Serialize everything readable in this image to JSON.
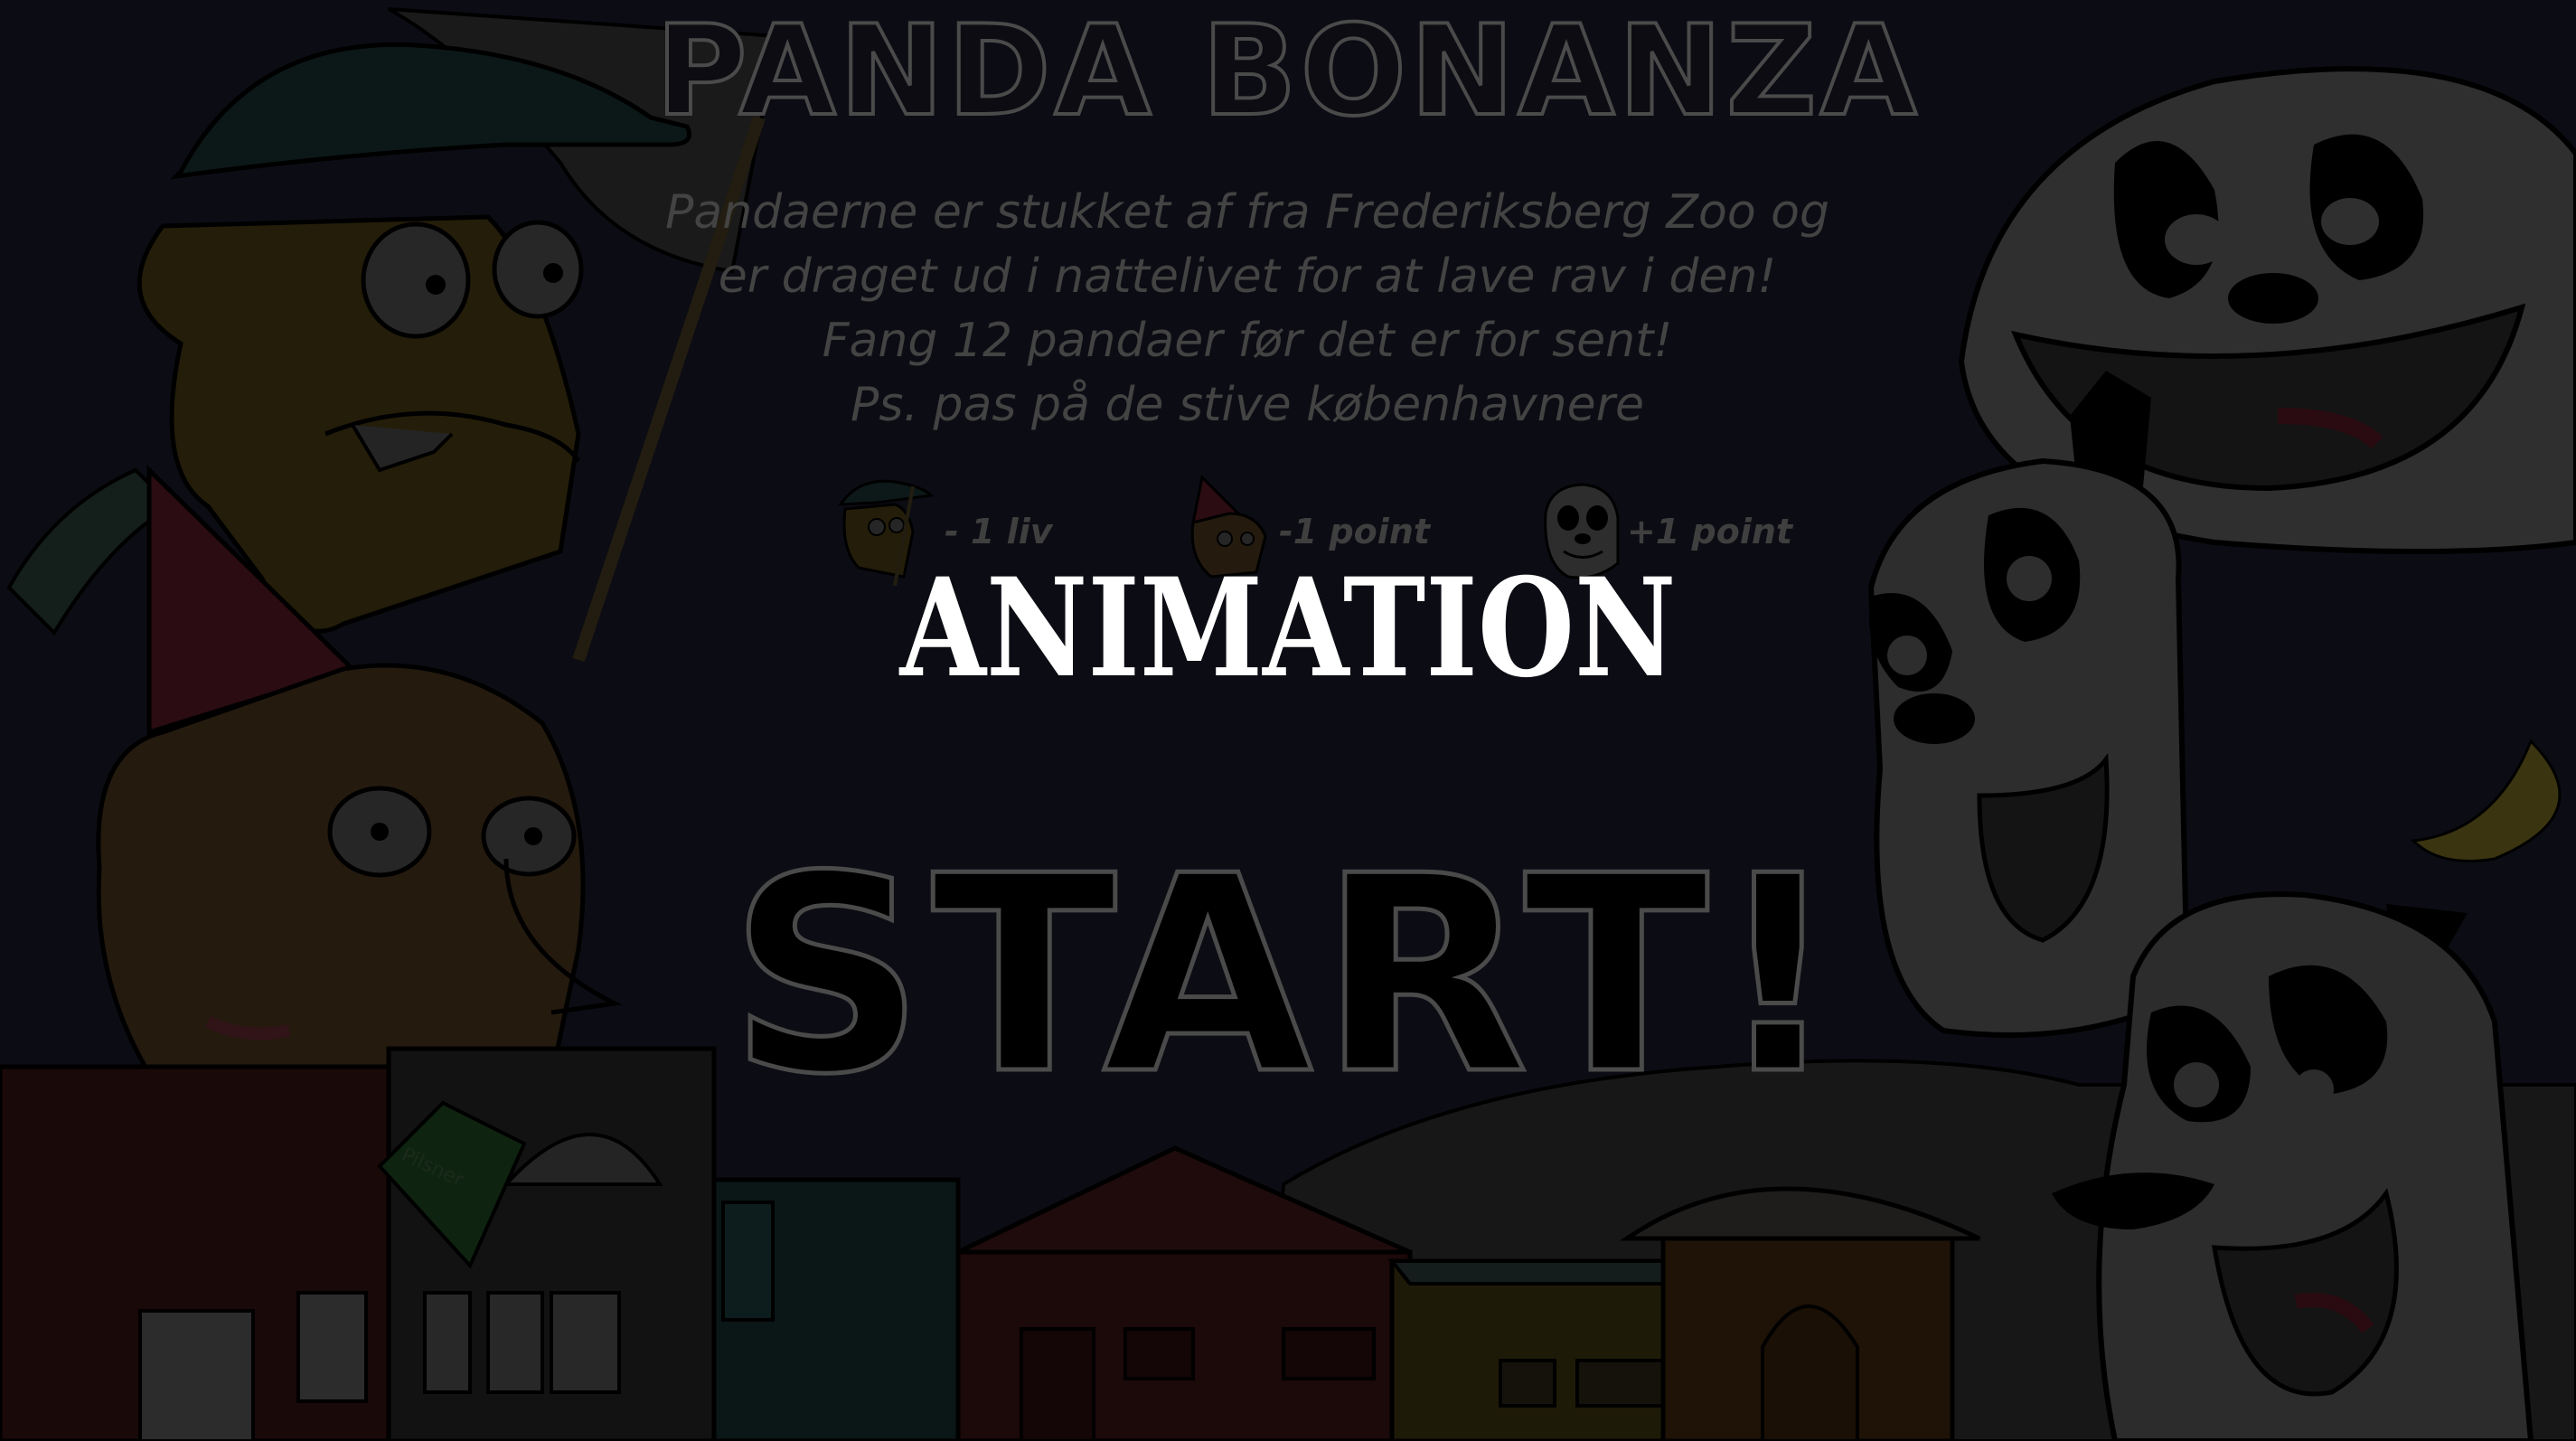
{
  "game": {
    "title": "PANDA BONANZA",
    "intro_lines": [
      "Pandaerne er stukket af fra Frederiksberg Zoo og",
      "er draget ud i nattelivet for at lave rav i den!",
      "Fang 12 pandaer før det er for sent!",
      "Ps. pas på de stive københavnere"
    ],
    "legend": [
      {
        "icon": "cap-man-face-icon",
        "label": "- 1 liv"
      },
      {
        "icon": "party-hat-man-face-icon",
        "label": "-1 point"
      },
      {
        "icon": "panda-face-icon",
        "label": "+1 point"
      }
    ],
    "overlay_text": "ANIMATION",
    "start_button": "START!",
    "bottle_label": "Pilsner"
  },
  "colors": {
    "background": "#0c0c14",
    "outline": "#4a4a4a",
    "overlay_text": "#ffffff",
    "moon": "#3a3410"
  }
}
